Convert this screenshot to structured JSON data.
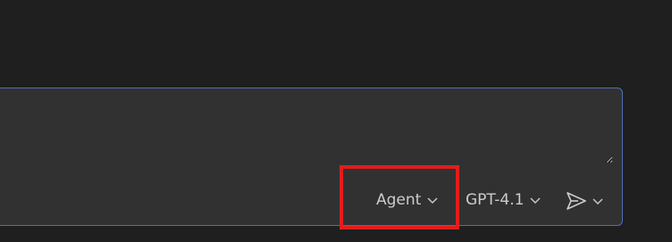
{
  "chat_input": {
    "placeholder": ""
  },
  "toolbar": {
    "mode_label": "Agent",
    "model_label": "GPT-4.1"
  },
  "icons": {
    "mode_chevron": "chevron-down-icon",
    "model_chevron": "chevron-down-icon",
    "send": "send-icon",
    "send_chevron": "chevron-down-icon"
  },
  "colors": {
    "background": "#1f1f1f",
    "input_background": "#313131",
    "input_border": "#4f6fb0",
    "text": "#cccccc",
    "highlight": "#e11d1d"
  }
}
